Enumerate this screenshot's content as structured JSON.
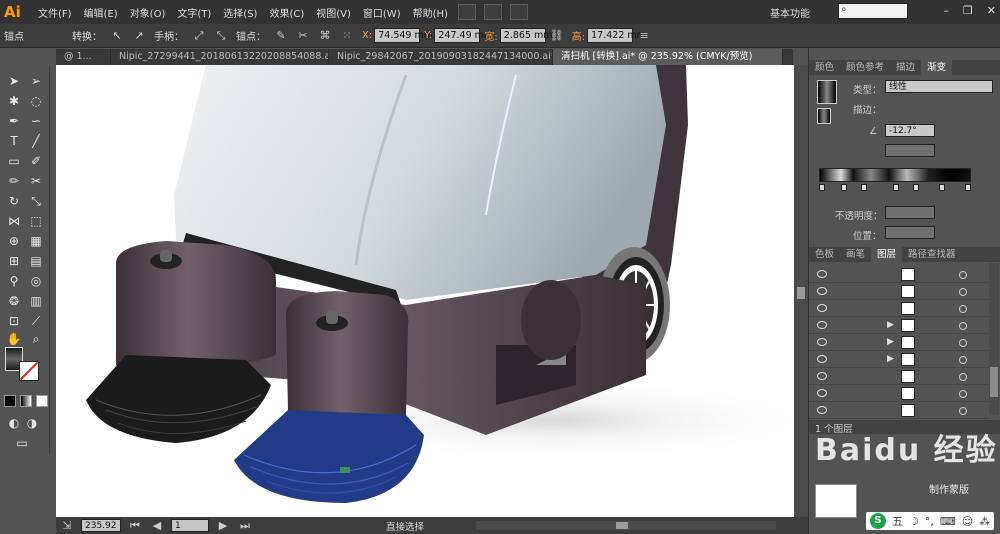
{
  "app": {
    "logo": "Ai",
    "menu": [
      "文件(F)",
      "编辑(E)",
      "对象(O)",
      "文字(T)",
      "选择(S)",
      "效果(C)",
      "视图(V)",
      "窗口(W)",
      "帮助(H)"
    ],
    "workspace": "基本功能",
    "search_placeholder": ""
  },
  "control_bar": {
    "anchor_label": "锚点",
    "convert_label": "转换：",
    "handle_label": "手柄：",
    "anchor2_label": "锚点：",
    "x_label": "X:",
    "x_value": "74.549 mm",
    "y_label": "Y:",
    "y_value": "247.49 mm",
    "w_label": "宽:",
    "w_value": "2.865 mm",
    "h_label": "高:",
    "h_value": "17.422 mm"
  },
  "tabs": [
    {
      "label": "@ 1..."
    },
    {
      "label": "Nipic_27299441_20180613220208854088.ai*"
    },
    {
      "label": "Nipic_29842067_20190903182447134000.ai*"
    },
    {
      "label": "清扫机 [转换].ai* @ 235.92% (CMYK/预览)"
    }
  ],
  "status": {
    "zoom": "235.92",
    "artboard": "1",
    "mode": "直接选择"
  },
  "gradient_panel": {
    "tabs": [
      "颜色",
      "颜色参考",
      "描边",
      "渐变"
    ],
    "type_label": "类型：",
    "type_value": "线性",
    "stroke_label": "描边：",
    "angle_value": "-12.7°",
    "opacity_label": "不透明度：",
    "position_label": "位置："
  },
  "layers_panel": {
    "tabs": [
      "色板",
      "画笔",
      "图层",
      "路径查找器"
    ],
    "footer": "1 个图层"
  },
  "watermark": {
    "text": "Baidu 经验",
    "sub": "制作蒙版"
  },
  "ime": {
    "logo": "S",
    "mode": "五"
  },
  "colors": {
    "accent": "#ff9a00",
    "machine_body": "#4a3c44",
    "hood": "#c9d2d7",
    "brush_blue": "#2f4ea8"
  }
}
